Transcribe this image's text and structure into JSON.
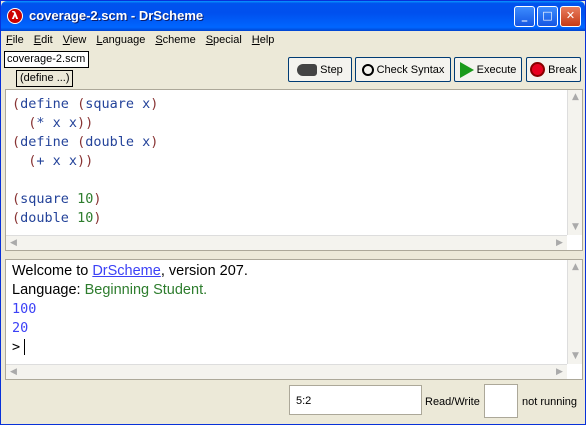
{
  "window": {
    "title": "coverage-2.scm - DrScheme",
    "icon": "drscheme-lambda-icon",
    "icon_glyph": "λ",
    "controls": {
      "minimize": "_",
      "maximize": "□",
      "close": "✕"
    }
  },
  "menubar": {
    "items": [
      {
        "first": "F",
        "rest": "ile"
      },
      {
        "first": "E",
        "rest": "dit"
      },
      {
        "first": "V",
        "rest": "iew"
      },
      {
        "first": "L",
        "rest": "anguage"
      },
      {
        "first": "S",
        "rest": "cheme"
      },
      {
        "first": "S",
        "rest": "pecial"
      },
      {
        "first": "H",
        "rest": "elp"
      }
    ]
  },
  "toolbar": {
    "filename": "coverage-2.scm",
    "define_menu": "(define ...)",
    "step_label": "Step",
    "check_label": "Check Syntax",
    "execute_label": "Execute",
    "break_label": "Break"
  },
  "editor": {
    "lines": [
      "(define (square x)",
      "  (* x x))",
      "(define (double x)",
      "  (+ x x))",
      "",
      "(square 10)",
      "(double 10)"
    ]
  },
  "interactions": {
    "welcome_prefix": "Welcome to ",
    "welcome_link": "DrScheme",
    "welcome_suffix": ", version 207.",
    "language_prefix": "Language: ",
    "language_name": "Beginning Student",
    "language_suffix": ".",
    "outputs": [
      "100",
      "20"
    ],
    "prompt": ">"
  },
  "statusbar": {
    "position": "5:2",
    "mode": "Read/Write",
    "state": "not running"
  },
  "colors": {
    "paren": "#883333",
    "keyword": "#24439a",
    "number": "#2e7d2e",
    "link": "#3c41f6",
    "titlebar": "#0050ee"
  }
}
